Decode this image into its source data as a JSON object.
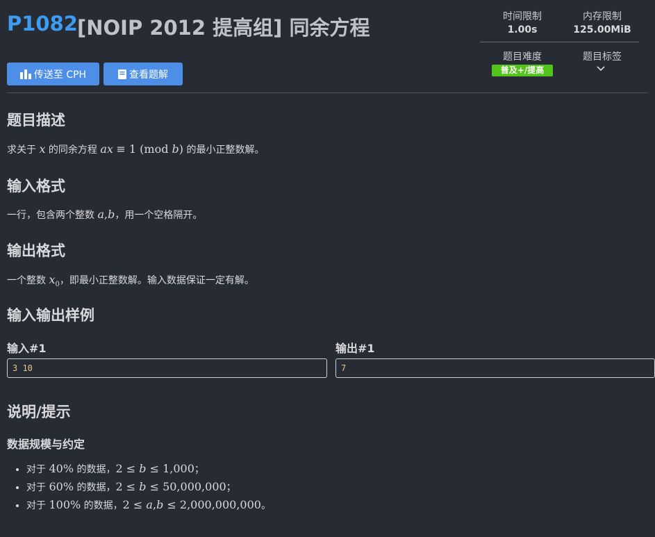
{
  "problem": {
    "id": "P1082",
    "title": "[NOIP 2012 提高组] 同余方程"
  },
  "stats": {
    "time_limit_label": "时间限制",
    "time_limit_value": "1.00s",
    "memory_limit_label": "内存限制",
    "memory_limit_value": "125.00MiB",
    "difficulty_label": "题目难度",
    "difficulty_value": "普及+/提高",
    "tags_label": "题目标签"
  },
  "actions": {
    "cph_label": "传送至 CPH",
    "solution_label": "查看题解"
  },
  "sections": {
    "description_title": "题目描述",
    "input_title": "输入格式",
    "output_title": "输出格式",
    "samples_title": "输入输出样例",
    "hint_title": "说明/提示",
    "constraints_title": "数据规模与约定"
  },
  "samples": {
    "input_label": "输入#1",
    "input_value": "3 10",
    "output_label": "输出#1",
    "output_value": "7"
  },
  "colors": {
    "accent": "#3d9cf0",
    "button": "#4d8ee6",
    "difficulty": "#52c41a",
    "background": "#272b33"
  }
}
